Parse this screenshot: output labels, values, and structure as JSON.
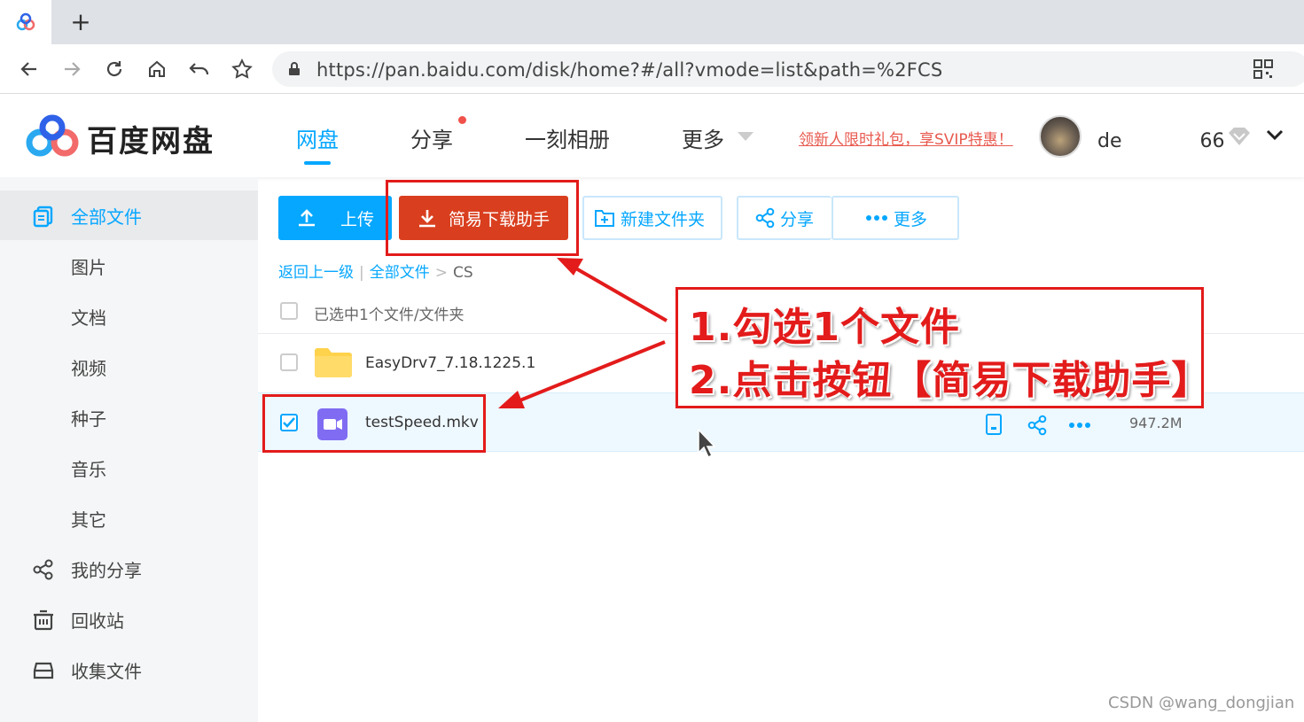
{
  "browser": {
    "new_tab": "+",
    "url": "https://pan.baidu.com/disk/home?#/all?vmode=list&path=%2FCS"
  },
  "header": {
    "brand": "百度网盘",
    "nav": [
      {
        "label": "网盘",
        "active": true
      },
      {
        "label": "分享",
        "badge": true
      },
      {
        "label": "一刻相册"
      },
      {
        "label": "更多",
        "dropdown": true
      }
    ],
    "promo": "领新人限时礼包，享SVIP特惠！",
    "username": "de　　　　66"
  },
  "sidebar": {
    "items": [
      {
        "label": "全部文件",
        "icon": "files-icon",
        "active": true
      },
      {
        "label": "图片"
      },
      {
        "label": "文档"
      },
      {
        "label": "视频"
      },
      {
        "label": "种子"
      },
      {
        "label": "音乐"
      },
      {
        "label": "其它"
      },
      {
        "label": "我的分享",
        "icon": "share-icon"
      },
      {
        "label": "回收站",
        "icon": "trash-icon"
      },
      {
        "label": "收集文件",
        "icon": "collect-icon"
      }
    ]
  },
  "toolbar": {
    "upload": "上传",
    "easy_download": "简易下载助手",
    "new_folder": "新建文件夹",
    "share": "分享",
    "more": "更多"
  },
  "breadcrumb": {
    "back": "返回上一级",
    "sep1": "|",
    "all": "全部文件",
    "sep2": ">",
    "current": "CS"
  },
  "list": {
    "selected_text": "已选中1个文件/文件夹",
    "files": [
      {
        "name": "EasyDrv7_7.18.1225.1",
        "type": "folder",
        "checked": false,
        "size": ""
      },
      {
        "name": "testSpeed.mkv",
        "type": "video",
        "checked": true,
        "size": "947.2M"
      }
    ]
  },
  "annotation": {
    "line1": "1.勾选1个文件",
    "line2": "2.点击按钮【简易下载助手】"
  },
  "watermark": "CSDN @wang_dongjian",
  "colors": {
    "accent": "#06a7ff",
    "download": "#d93f1f",
    "annotation": "#e31b1b"
  }
}
